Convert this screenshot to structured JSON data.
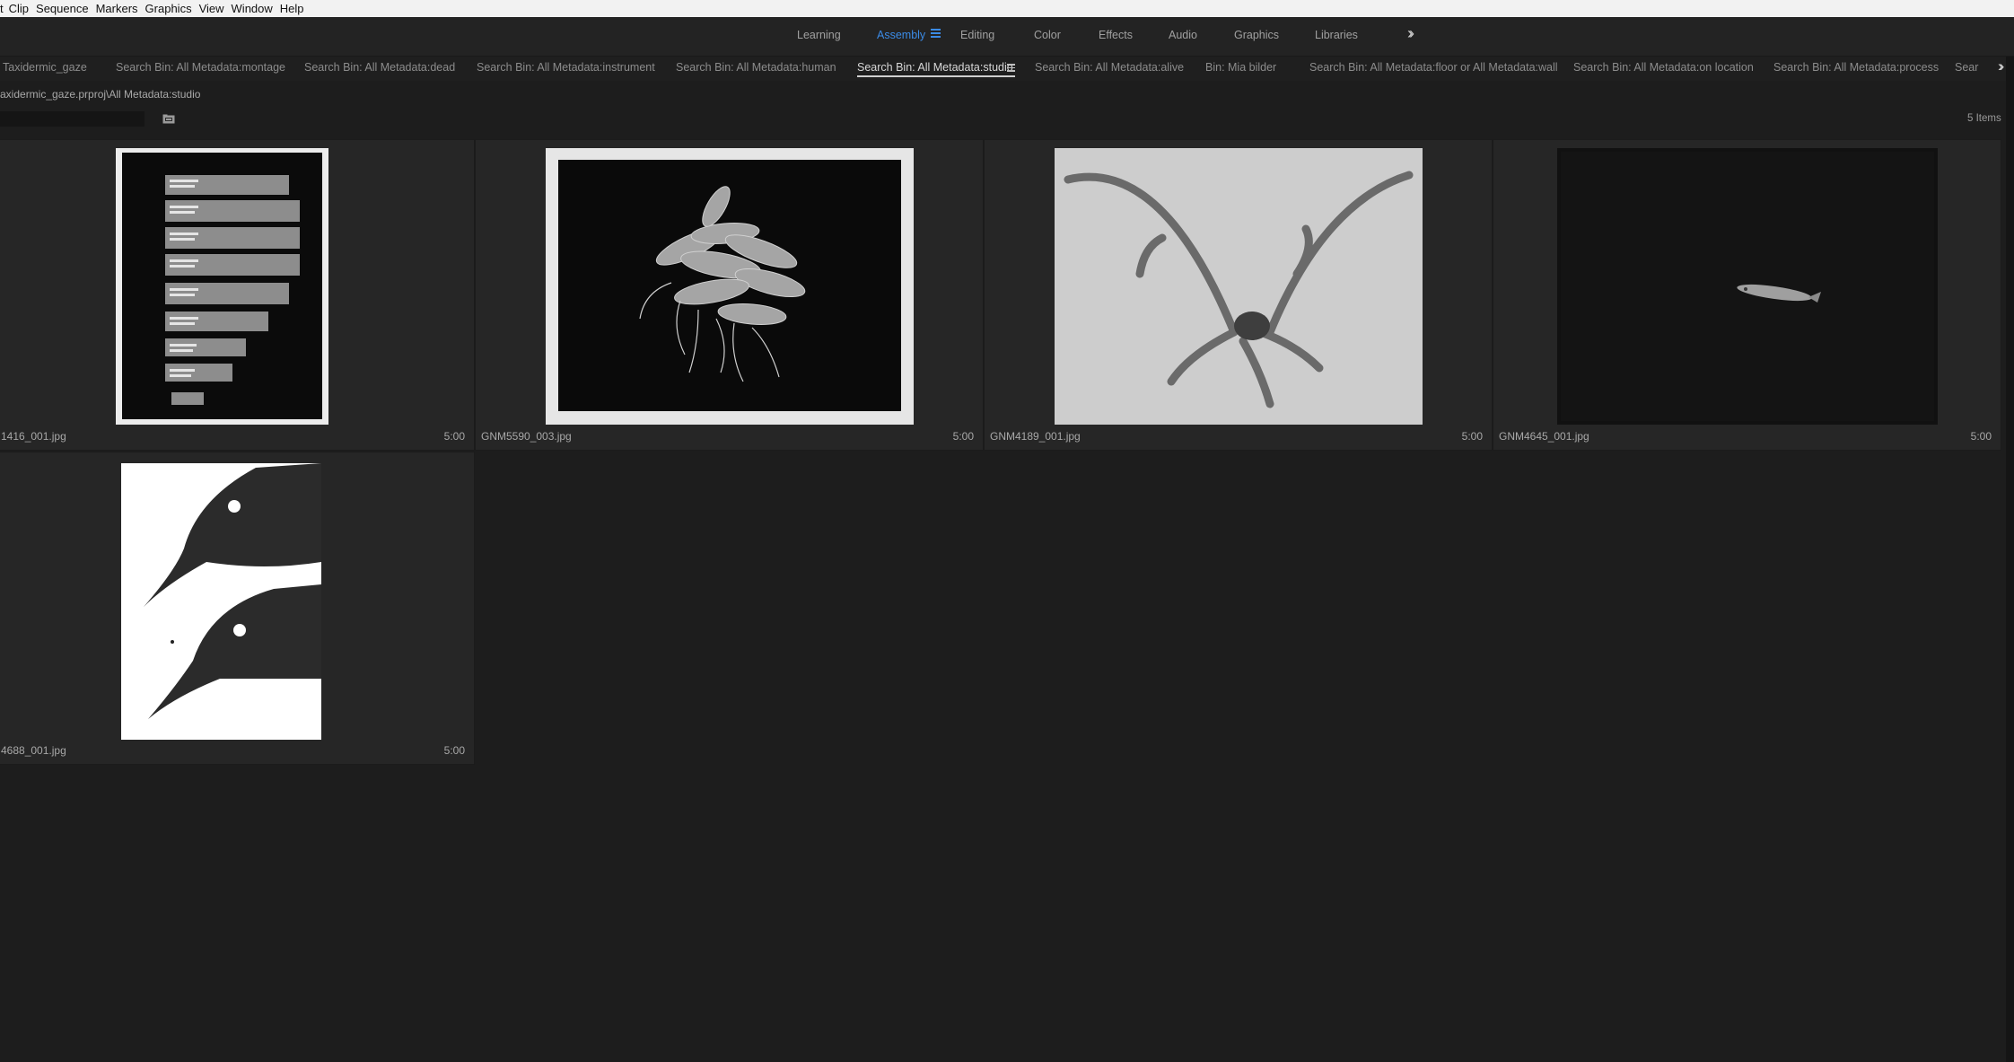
{
  "menu": [
    "t",
    "Clip",
    "Sequence",
    "Markers",
    "Graphics",
    "View",
    "Window",
    "Help"
  ],
  "workspaces": {
    "tabs": [
      "Learning",
      "Assembly",
      "Editing",
      "Color",
      "Effects",
      "Audio",
      "Graphics",
      "Libraries"
    ],
    "active": "Assembly",
    "more_icon": "double-chevron-right-icon"
  },
  "panel_tabs": [
    "Taxidermic_gaze",
    "Search Bin: All Metadata:montage",
    "Search Bin: All Metadata:dead",
    "Search Bin: All Metadata:instrument",
    "Search Bin: All Metadata:human",
    "Search Bin: All Metadata:studio",
    "Search Bin: All Metadata:alive",
    "Bin: Mia bilder",
    "Search Bin: All Metadata:floor or All Metadata:wall",
    "Search Bin: All Metadata:on location",
    "Search Bin: All Metadata:process",
    "Sear"
  ],
  "active_panel_tab": "Search Bin: All Metadata:studio",
  "bin_path": "axidermic_gaze.prproj\\All Metadata:studio",
  "search": {
    "value": "",
    "placeholder": ""
  },
  "items_count": "5 Items",
  "items": [
    {
      "name": "1416_001.jpg",
      "duration": "5:00"
    },
    {
      "name": "GNM5590_003.jpg",
      "duration": "5:00"
    },
    {
      "name": "GNM4189_001.jpg",
      "duration": "5:00"
    },
    {
      "name": "GNM4645_001.jpg",
      "duration": "5:00"
    },
    {
      "name": "4688_001.jpg",
      "duration": "5:00"
    }
  ]
}
